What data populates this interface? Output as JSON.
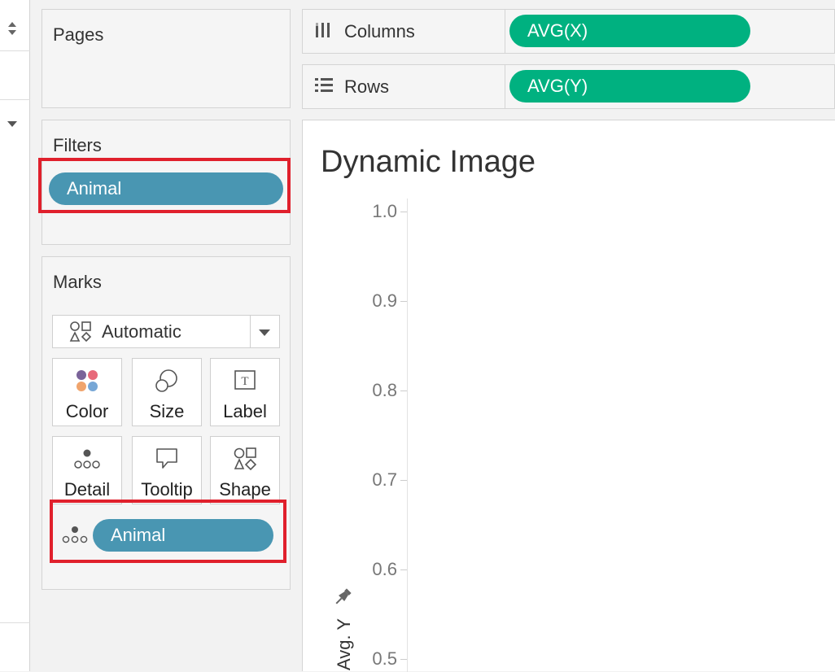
{
  "pages": {
    "title": "Pages"
  },
  "filters": {
    "title": "Filters",
    "pill": "Animal"
  },
  "marks": {
    "title": "Marks",
    "dropdown": "Automatic",
    "cards": [
      "Color",
      "Size",
      "Label",
      "Detail",
      "Tooltip",
      "Shape"
    ],
    "detail_pill": "Animal"
  },
  "shelves": {
    "columns_label": "Columns",
    "columns_pill": "AVG(X)",
    "rows_label": "Rows",
    "rows_pill": "AVG(Y)"
  },
  "view": {
    "title": "Dynamic Image",
    "y_axis_label": "Avg. Y"
  },
  "chart_data": {
    "type": "scatter",
    "title": "Dynamic Image",
    "ylabel": "Avg. Y",
    "y_ticks": [
      "1.0",
      "0.9",
      "0.8",
      "0.7",
      "0.6",
      "0.5"
    ],
    "ylim": [
      0.5,
      1.0
    ],
    "series": []
  },
  "colors": {
    "filter_pill": "#4996b2",
    "shelf_pill": "#00b180",
    "highlight": "#e0202c"
  }
}
